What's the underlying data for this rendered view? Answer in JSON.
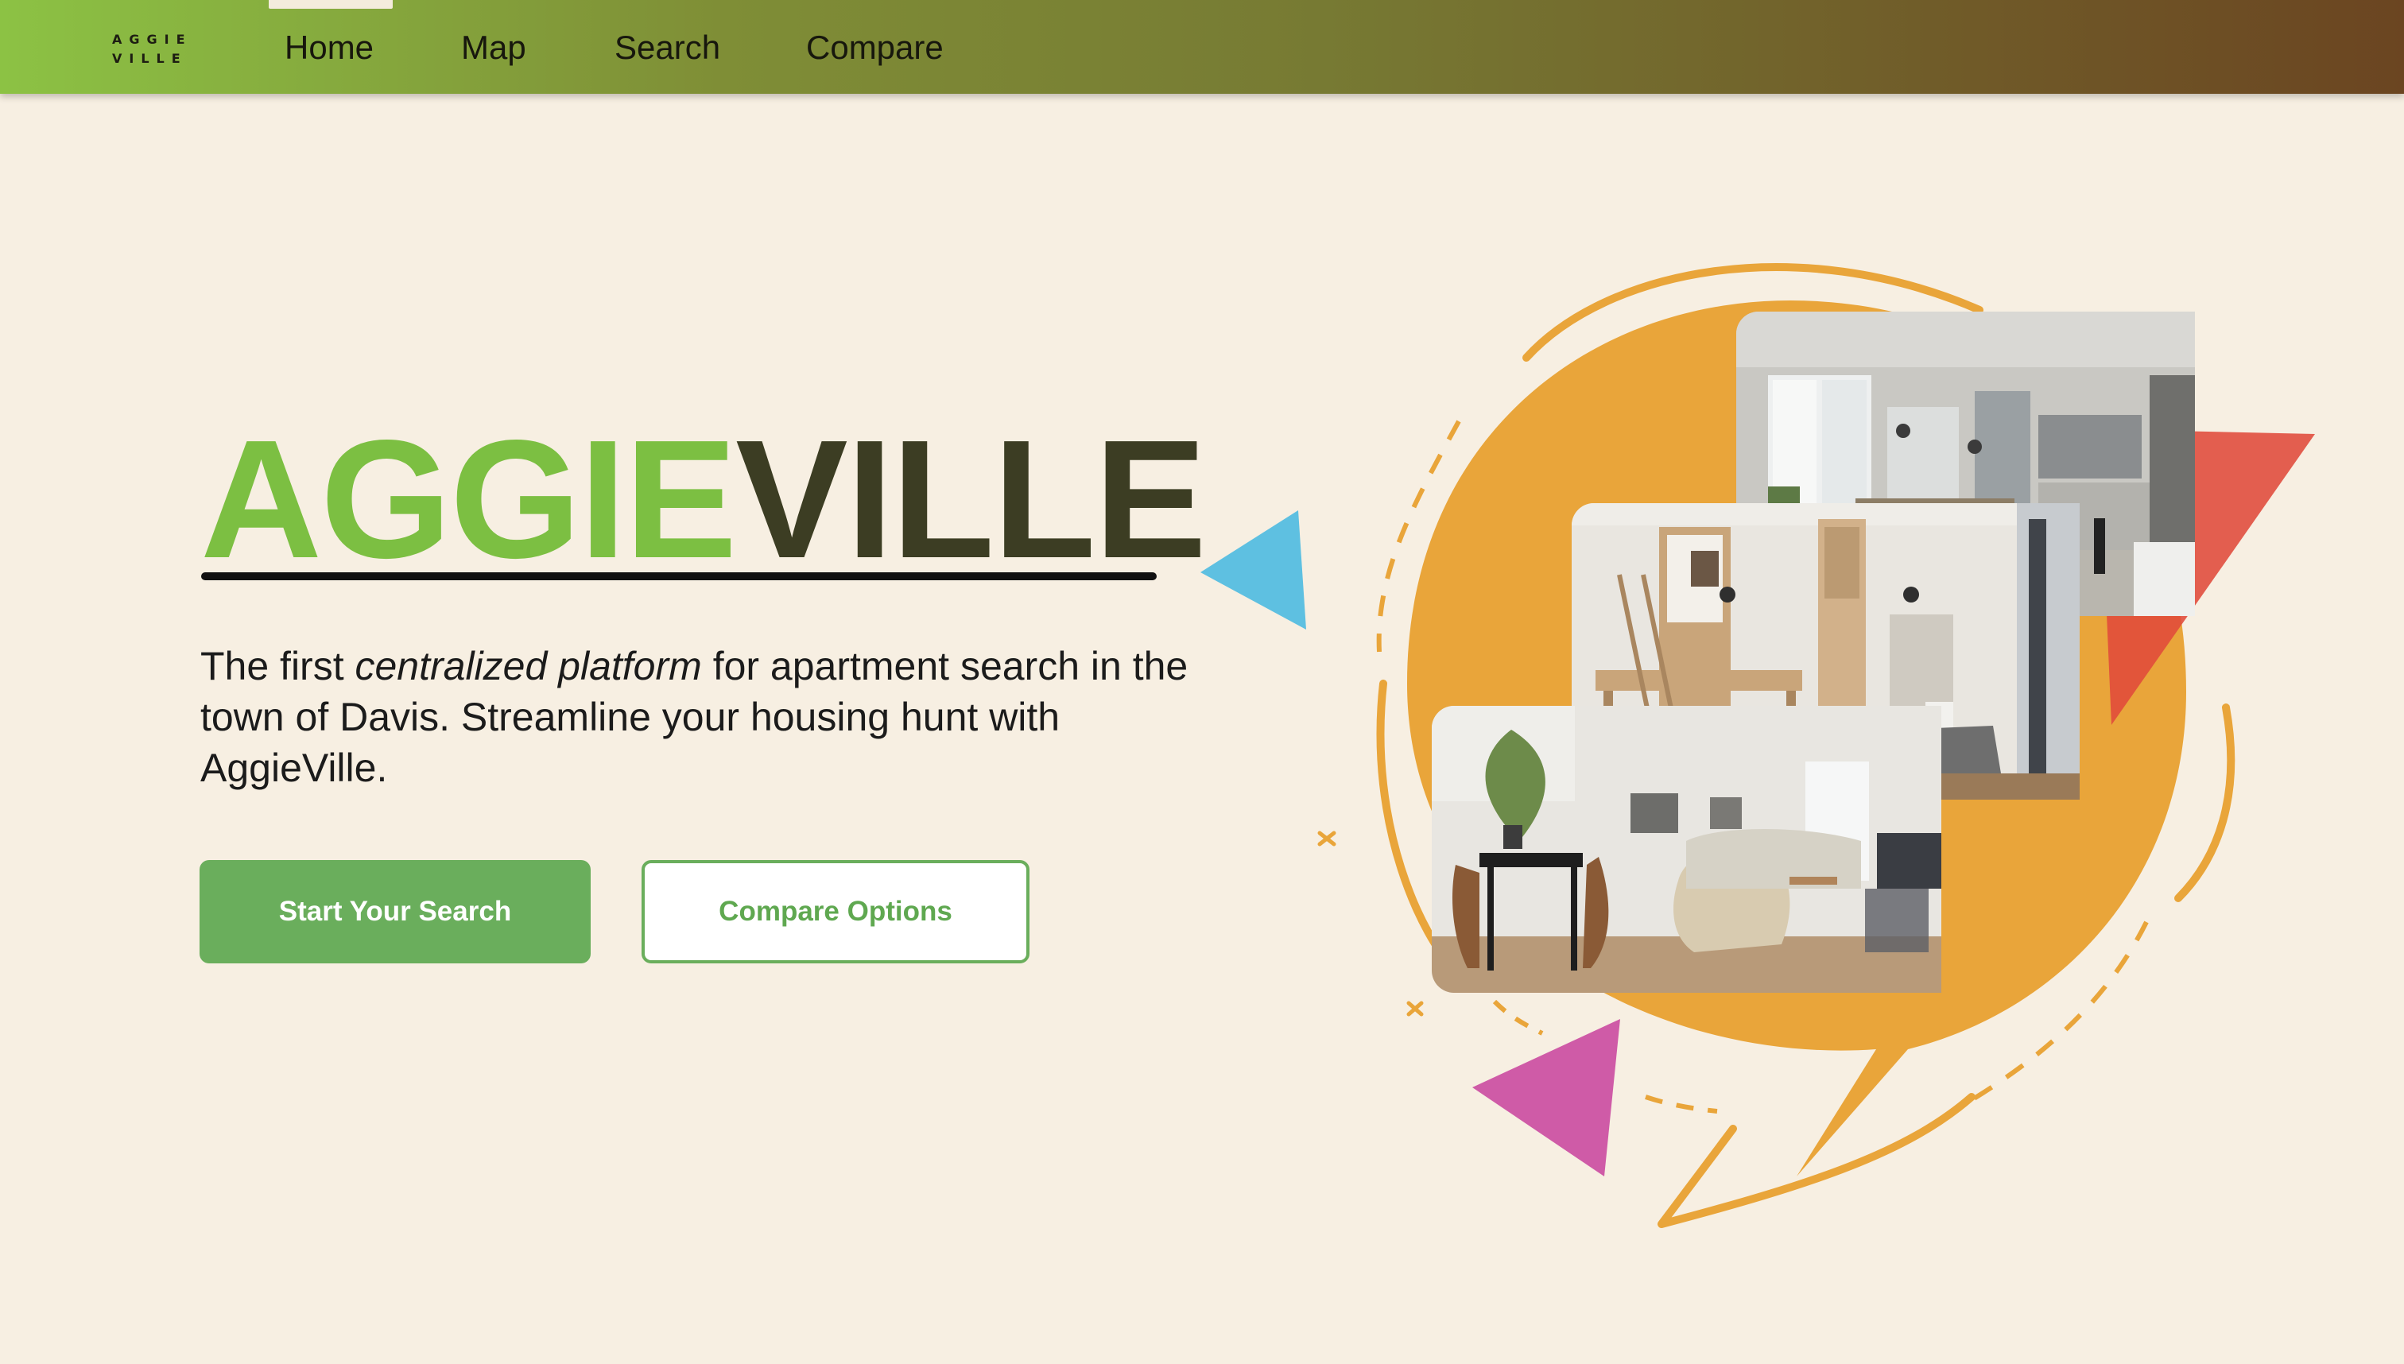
{
  "nav": {
    "logo_line1": "AGGIE",
    "logo_line2": "VILLE",
    "items": [
      {
        "label": "Home",
        "active": true
      },
      {
        "label": "Map",
        "active": false
      },
      {
        "label": "Search",
        "active": false
      },
      {
        "label": "Compare",
        "active": false
      }
    ]
  },
  "hero": {
    "title_part1": "AGGIE",
    "title_part2": "VILLE",
    "tagline_prefix": "The first ",
    "tagline_emphasis": "centralized platform",
    "tagline_suffix": " for apartment search in the town of Davis. Streamline your housing hunt with AggieVille.",
    "primary_button": "Start Your Search",
    "secondary_button": "Compare Options"
  },
  "colors": {
    "background": "#f7efe2",
    "brand_green": "#7cbf42",
    "brand_dark": "#3c3d23",
    "button_green": "#6aae5c",
    "accent_orange": "#e9a53a",
    "accent_blue": "#55bde0",
    "accent_red": "#e04a3a",
    "accent_magenta": "#c9479e"
  },
  "icons": {
    "logo": "aggieville-wordmark",
    "decorations": [
      "blue-triangle",
      "red-triangle",
      "magenta-triangle",
      "sparkle-cross"
    ]
  }
}
